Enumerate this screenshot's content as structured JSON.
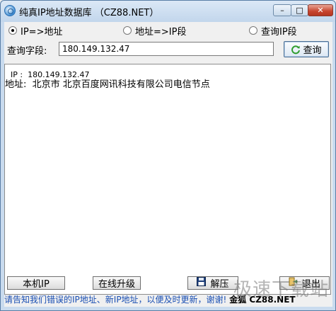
{
  "window": {
    "title": "纯真IP地址数据库 （CZ88.NET）"
  },
  "titlebar": {
    "min_symbol": "–",
    "max_symbol": "□",
    "close_symbol": "✕"
  },
  "modes": {
    "ip_to_addr": "IP=>地址",
    "addr_to_ip": "地址=>IP段",
    "query_ip_range": "查询IP段",
    "selected": "ip_to_addr"
  },
  "query": {
    "label": "查询字段:",
    "value": "180.149.132.47",
    "button_label": "查询"
  },
  "result": {
    "line1": "IP :  180.149.132.47",
    "line2": "地址:  北京市 北京百度网讯科技有限公司电信节点"
  },
  "bottom_buttons": {
    "local_ip": "本机IP",
    "online_upgrade": "在线升级",
    "decode": "解压",
    "exit": "退出"
  },
  "status": {
    "text": "请告知我们错误的IP地址、新IP地址，以便及时更新，谢谢!",
    "brand": "金狐 CZ88.NET"
  },
  "watermark": {
    "text": "极速下载站"
  },
  "colors": {
    "title_bg": "#c2d6ec",
    "close_button": "#c7442e",
    "status_text": "#1a4fb3",
    "refresh_icon": "#2e9d2e"
  },
  "icons": {
    "app": "globe-icon",
    "query": "refresh-icon",
    "decode": "floppy-disk-icon",
    "exit": "exit-icon"
  }
}
